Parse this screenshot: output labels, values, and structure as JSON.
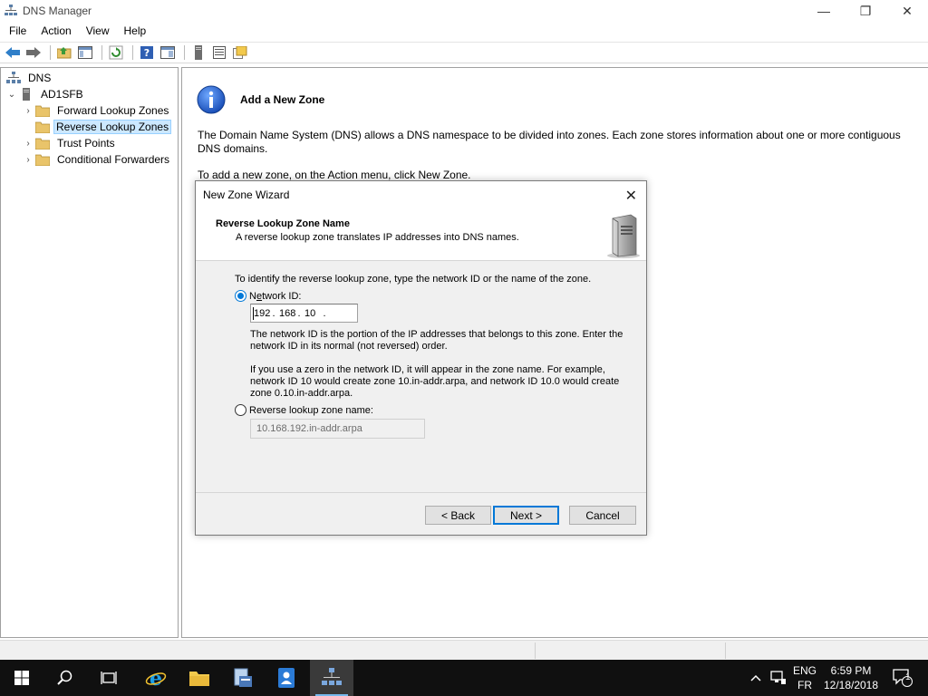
{
  "window": {
    "title": "DNS Manager",
    "controls": {
      "minimize": "—",
      "restore": "❐",
      "close": "✕"
    }
  },
  "menu": [
    "File",
    "Action",
    "View",
    "Help"
  ],
  "tree": {
    "root": "DNS",
    "server": "AD1SFB",
    "items": [
      "Forward Lookup Zones",
      "Reverse Lookup Zones",
      "Trust Points",
      "Conditional Forwarders"
    ],
    "selected_index": 1
  },
  "main": {
    "heading": "Add a New Zone",
    "description": "The Domain Name System (DNS) allows a DNS namespace to be divided into zones. Each zone stores information about one or more contiguous DNS domains.",
    "instruction": "To add a new zone, on the Action menu, click New Zone."
  },
  "wizard": {
    "title": "New Zone Wizard",
    "close": "✕",
    "header_title": "Reverse Lookup Zone Name",
    "header_subtitle": "A reverse lookup zone translates IP addresses into DNS names.",
    "prompt": "To identify the reverse lookup zone, type the network ID or the name of the zone.",
    "network_id_label": "Network ID:",
    "network_id_mnemonic": "e",
    "octets": [
      "192",
      "168",
      "10",
      ""
    ],
    "help1": "The network ID is the portion of the IP addresses that belongs to this zone. Enter the network ID in its normal (not reversed) order.",
    "help2": "If you use a zero in the network ID, it will appear in the zone name. For example, network ID 10 would create zone 10.in-addr.arpa, and network ID 10.0 would create zone 0.10.in-addr.arpa.",
    "zone_name_label": "Reverse lookup zone name:",
    "zone_name_value": "10.168.192.in-addr.arpa",
    "buttons": {
      "back": "< Back",
      "next": "Next >",
      "cancel": "Cancel"
    },
    "selected_option": "network_id"
  },
  "taskbar": {
    "lang_top": "ENG",
    "lang_bottom": "FR",
    "time": "6:59 PM",
    "date": "12/18/2018",
    "notification_count": "1"
  },
  "colors": {
    "accent": "#0078d7",
    "selection": "#cce8ff",
    "taskbar": "#101010"
  }
}
